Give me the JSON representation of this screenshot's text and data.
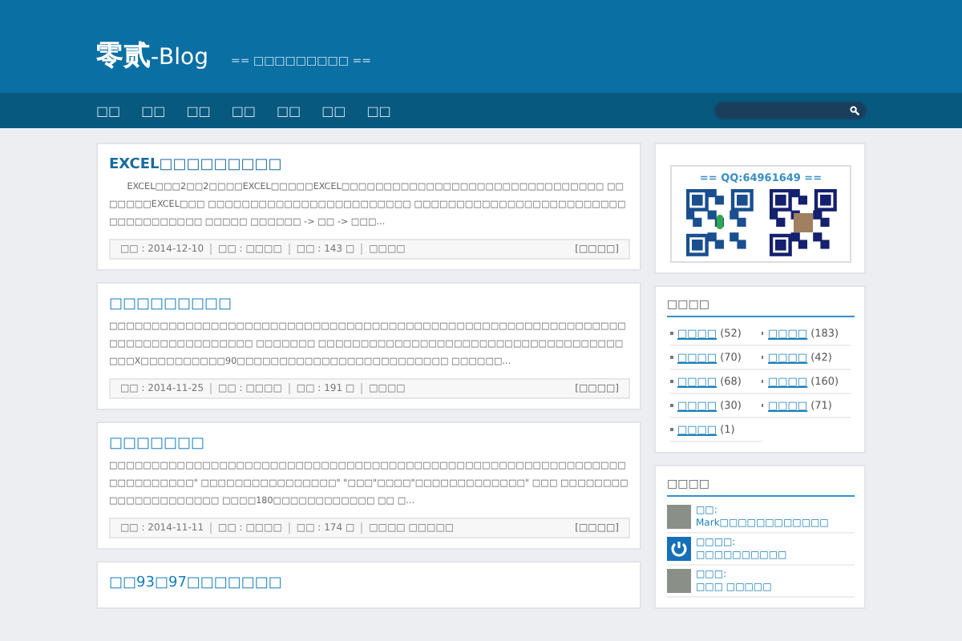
{
  "header": {
    "logo_main": "零贰",
    "logo_suffix": "-Blog",
    "tagline": "== □□□□□□□□□ =="
  },
  "nav": {
    "items": [
      "□□",
      "□□",
      "□□",
      "□□",
      "□□",
      "□□",
      "□□"
    ]
  },
  "posts": [
    {
      "title": "EXCEL□□□□□□□□□",
      "excerpt": "EXCEL□□□2□□2□□□□EXCEL□□□□□EXCEL□□□□□□□□□□□□□□□□□□□□□□□□□□□□□□□ □□□□□□□EXCEL□□□ □□□□□□□□□□□□□□□□□□□□□□□□ □□□□□□□□□□□□□□□□□□□□□□□□□□□□□□□□□□□□ □□□□□ □□□□□□ -> □□ -> □□□...",
      "indent": true,
      "meta": [
        "□□ : 2014-12-10",
        "□□ : □□□□",
        "□□ : 143 □",
        "□□□□"
      ],
      "more": "[□□□□]"
    },
    {
      "title": "□□□□□□□□□",
      "excerpt": "□□□□□□□□□□□□□□□□□□□□□□□□□□□□□□□□□□□□□□□□□□□□□□□□□□□□□□□□□□□□□□□□□□□□□□□□□□□□□□ □□□□□□□ □□□□□□□□□□□□□□□□□□□□□□□□□□□□□□□□□□□□□□□X□□□□□□□□□□90□□□□□□□□□□□□□□□□□□□□□□□□□ □□□□□□...",
      "indent": false,
      "meta": [
        "□□ : 2014-11-25",
        "□□ : □□□□",
        "□□ : 191 □",
        "□□□□"
      ],
      "more": "[□□□□]"
    },
    {
      "title": "□□□□□□□",
      "excerpt": "□□□□□□□□□□□□□□□□□□□□□□□□□□□□□□□□□□□□□□□□□□□□□□□□□□□□□□□□□□□□□□□□□□□□□□□\" □□□□□□□□□□□□□□□□\" \"□□□\"□□□□\"□□□□□□□□□□□□□\" □□□ □□□□□□□□□□□□□□□□□□□□□ □□□□180□□□□□□□□□□□□ □□ □...",
      "indent": false,
      "meta": [
        "□□ : 2014-11-11",
        "□□ : □□□□",
        "□□ : 174 □",
        "□□□□  □□□□□"
      ],
      "more": "[□□□□]"
    },
    {
      "title": "□□93□97□□□□□□□"
    }
  ],
  "sidebar": {
    "qr": {
      "caption": "== QQ:64961649 =="
    },
    "categories": {
      "title": "□□□□",
      "items": [
        {
          "name": "□□□□",
          "count": "(52)"
        },
        {
          "name": "□□□□",
          "count": "(183)"
        },
        {
          "name": "□□□□",
          "count": "(70)"
        },
        {
          "name": "□□□□",
          "count": "(42)"
        },
        {
          "name": "□□□□",
          "count": "(68)"
        },
        {
          "name": "□□□□",
          "count": "(160)"
        },
        {
          "name": "□□□□",
          "count": "(30)"
        },
        {
          "name": "□□□□",
          "count": "(71)"
        },
        {
          "name": "□□□□",
          "count": "(1)"
        }
      ]
    },
    "comments": {
      "title": "□□□□",
      "items": [
        {
          "kind": "photo",
          "author": "□□:",
          "text": "Mark□□□□□□□□□□□□"
        },
        {
          "kind": "power",
          "author": "□□□□:",
          "text": "□□□□□□□□□□"
        },
        {
          "kind": "photo",
          "author": "□□□:",
          "text": "□□□ □□□□□"
        }
      ]
    }
  }
}
